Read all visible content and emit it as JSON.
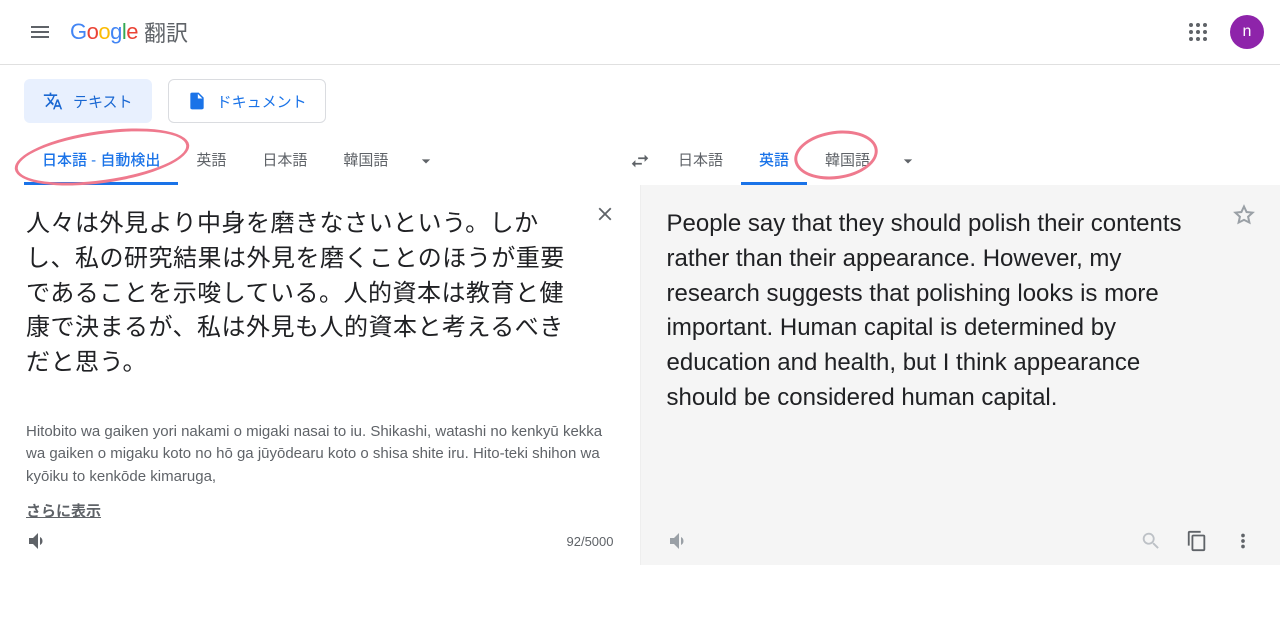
{
  "header": {
    "product_suffix": "翻訳",
    "avatar_initial": "n"
  },
  "modes": {
    "text": "テキスト",
    "document": "ドキュメント"
  },
  "source_langs": {
    "detect": "日本語 - 自動検出",
    "tab2": "英語",
    "tab3": "日本語",
    "tab4": "韓国語"
  },
  "target_langs": {
    "tab1": "日本語",
    "tab2": "英語",
    "tab3": "韓国語"
  },
  "source": {
    "text": "人々は外見より中身を磨きなさいという。しかし、私の研究結果は外見を磨くことのほうが重要であることを示唆している。人的資本は教育と健康で決まるが、私は外見も人的資本と考えるべきだと思う。",
    "romaji": "Hitobito wa gaiken yori nakami o migaki nasai to iu. Shikashi, watashi no kenkyū kekka wa gaiken o migaku koto no hō ga jūyōdearu koto o shisa shite iru. Hito-teki shihon wa kyōiku to kenkōde kimaruga,",
    "show_more": "さらに表示",
    "char_count": "92/5000"
  },
  "target": {
    "text": "People say that they should polish their contents rather than their appearance. However, my research suggests that polishing looks is more important. Human capital is determined by education and health, but I think appearance should be considered human capital."
  }
}
